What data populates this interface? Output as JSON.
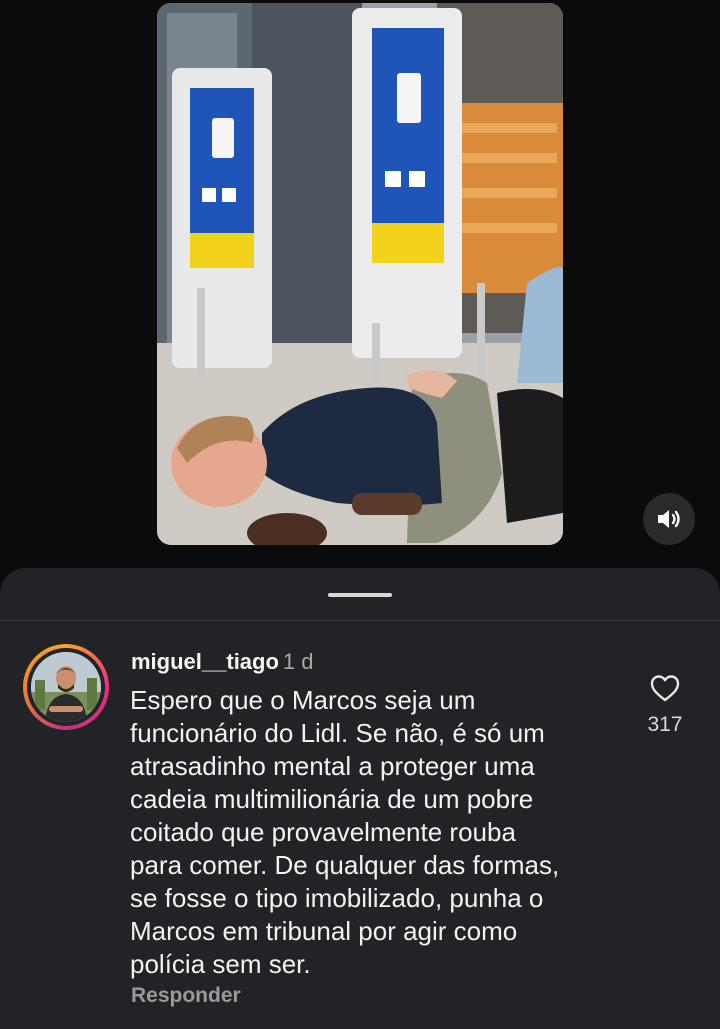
{
  "video": {
    "sound_icon": "speaker-volume-icon"
  },
  "comment": {
    "username": "miguel__tiago",
    "time": "1 d",
    "text": "Espero que o Marcos seja um\nfuncionário do Lidl. Se não, é só um\natrasadinho mental a proteger uma\ncadeia multimilionária de um pobre\ncoitado que provavelmente rouba\npara comer. De qualquer das formas,\nse fosse o tipo imobilizado, punha o\nMarcos em tribunal por agir como\npolícia sem ser.",
    "reply_label": "Responder",
    "like_icon": "heart-outline-icon",
    "like_count": "317"
  },
  "colors": {
    "background": "#0b0b0b",
    "sheet": "#212327",
    "story_ring": "#ee2a7b",
    "secondary_text": "#a8a8a8"
  }
}
